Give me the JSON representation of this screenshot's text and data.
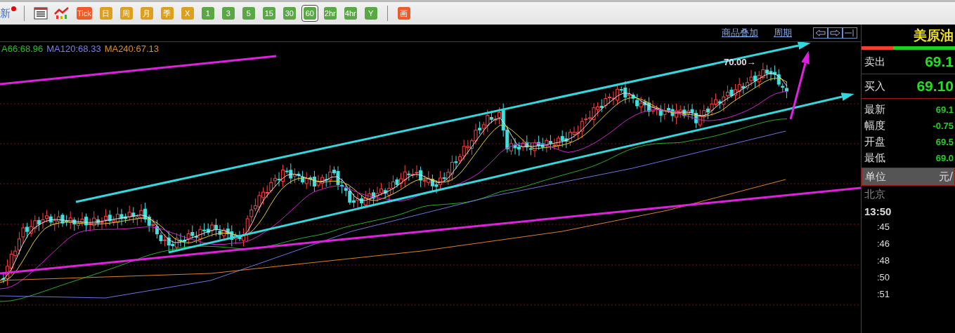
{
  "toolbar": {
    "news": {
      "label": "新",
      "unread": true
    },
    "buttons": [
      {
        "kind": "table"
      },
      {
        "kind": "trend"
      },
      {
        "kind": "text",
        "label": "Tick",
        "color": "#ef5a2a",
        "selected": false
      },
      {
        "kind": "text",
        "label": "日",
        "color": "#dca020",
        "selected": false
      },
      {
        "kind": "text",
        "label": "周",
        "color": "#dca020",
        "selected": false
      },
      {
        "kind": "text",
        "label": "月",
        "color": "#dca020",
        "selected": false
      },
      {
        "kind": "text",
        "label": "季",
        "color": "#dca020",
        "selected": false
      },
      {
        "kind": "text",
        "label": "X",
        "color": "#dca020",
        "selected": false
      },
      {
        "kind": "text",
        "label": "1",
        "color": "#5aa845",
        "selected": false
      },
      {
        "kind": "text",
        "label": "3",
        "color": "#5aa845",
        "selected": false
      },
      {
        "kind": "text",
        "label": "5",
        "color": "#5aa845",
        "selected": false
      },
      {
        "kind": "text",
        "label": "15",
        "color": "#5aa845",
        "selected": false
      },
      {
        "kind": "text",
        "label": "30",
        "color": "#5aa845",
        "selected": false
      },
      {
        "kind": "text",
        "label": "60",
        "color": "#5aa845",
        "selected": true
      },
      {
        "kind": "text",
        "label": "2hr",
        "color": "#5aa845",
        "selected": false
      },
      {
        "kind": "text",
        "label": "4hr",
        "color": "#5aa845",
        "selected": false
      },
      {
        "kind": "text",
        "label": "Y",
        "color": "#5aa845",
        "selected": false
      },
      {
        "kind": "divider"
      },
      {
        "kind": "text",
        "label": "画",
        "color": "#ef5a2a",
        "selected": false
      }
    ]
  },
  "chart": {
    "links": [
      "商品叠加",
      "周期"
    ],
    "legend": [
      {
        "text": "A66:68.96",
        "color": "#22c022"
      },
      {
        "text": "MA120:68.33",
        "color": "#7c7cf0"
      },
      {
        "text": "MA240:67.13",
        "color": "#e08a20"
      }
    ],
    "high_marker": "70.00→"
  },
  "quote": {
    "title": "美原油",
    "big_rows": [
      {
        "label": "卖出",
        "value": "69.1"
      },
      {
        "label": "买入",
        "value": "69.10"
      }
    ],
    "rows": [
      {
        "label": "最新",
        "value": "69.1"
      },
      {
        "label": "幅度",
        "value": "-0.75"
      },
      {
        "label": "开盘",
        "value": "69.5"
      },
      {
        "label": "最低",
        "value": "69.0"
      }
    ],
    "unit": {
      "label": "单位",
      "value": "元/"
    },
    "city": "北京",
    "times": [
      {
        "text": "13:50",
        "kind": "hour"
      },
      {
        "text": ":45",
        "kind": "minute"
      },
      {
        "text": ":46",
        "kind": "minute"
      },
      {
        "text": ":48",
        "kind": "minute"
      },
      {
        "text": ":50",
        "kind": "minute"
      },
      {
        "text": ":51",
        "kind": "minute"
      }
    ]
  }
}
